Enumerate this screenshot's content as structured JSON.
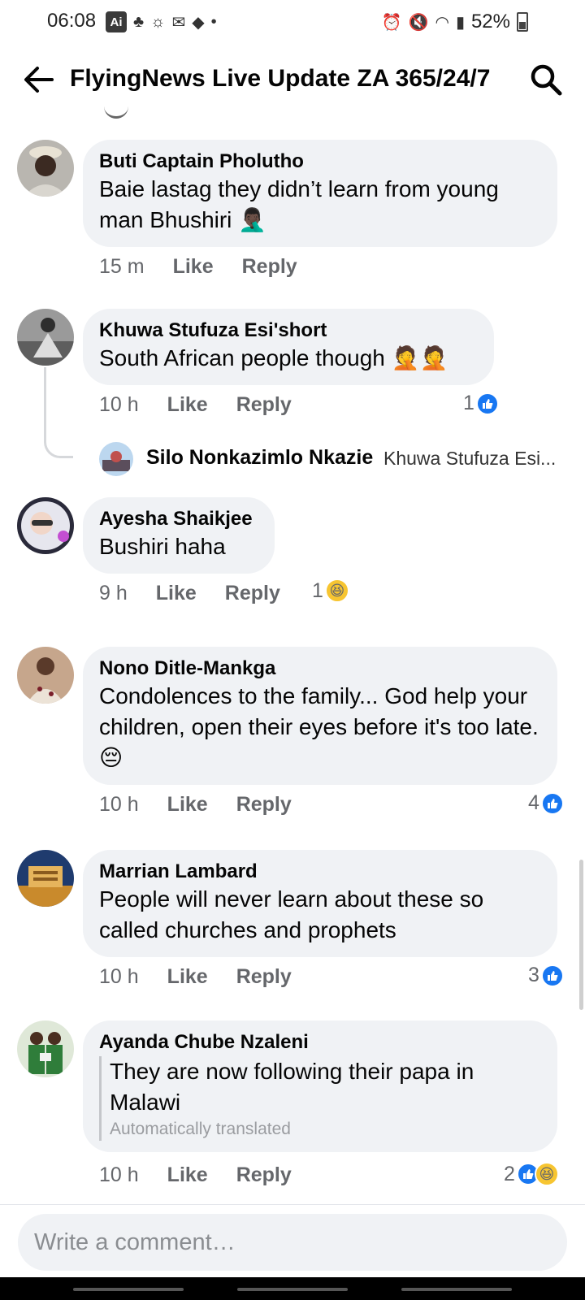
{
  "status_bar": {
    "time": "06:08",
    "ai_badge": "Ai",
    "battery": "52%"
  },
  "header": {
    "title": "FlyingNews Live Update ZA 365/24/7"
  },
  "comments": [
    {
      "author": "Buti Captain Pholutho",
      "text": "Baie lastag they didn’t learn from young man Bhushiri 🤦🏿‍♂️",
      "time": "15 m",
      "like_label": "Like",
      "reply_label": "Reply",
      "reaction_count": ""
    },
    {
      "author": "Khuwa Stufuza Esi'short",
      "text": "South African people though 🤦🤦",
      "time": "10 h",
      "like_label": "Like",
      "reply_label": "Reply",
      "reaction_count": "1"
    },
    {
      "author": "Ayesha Shaikjee",
      "text": "Bushiri haha",
      "time": "9 h",
      "like_label": "Like",
      "reply_label": "Reply",
      "reaction_count": "1"
    },
    {
      "author": "Nono Ditle-Mankga",
      "text": "Condolences to the family... God help your children, open their eyes before it's too late. 😔",
      "time": "10 h",
      "like_label": "Like",
      "reply_label": "Reply",
      "reaction_count": "4"
    },
    {
      "author": "Marrian Lambard",
      "text": "People will never learn about these so called churches and prophets",
      "time": "10 h",
      "like_label": "Like",
      "reply_label": "Reply",
      "reaction_count": "3"
    },
    {
      "author": "Ayanda Chube Nzaleni",
      "text": "They are now following their papa in Malawi",
      "translated_note": "Automatically translated",
      "time": "10 h",
      "like_label": "Like",
      "reply_label": "Reply",
      "reaction_count": "2"
    }
  ],
  "reply_preview": {
    "name": "Silo Nonkazimlo Nkazie",
    "snippet": "Khuwa Stufuza Esi..."
  },
  "composer": {
    "placeholder": "Write a comment…"
  },
  "colors": {
    "bubble": "#f0f2f5",
    "like_blue": "#1877f2",
    "secondary_text": "#65676b"
  }
}
